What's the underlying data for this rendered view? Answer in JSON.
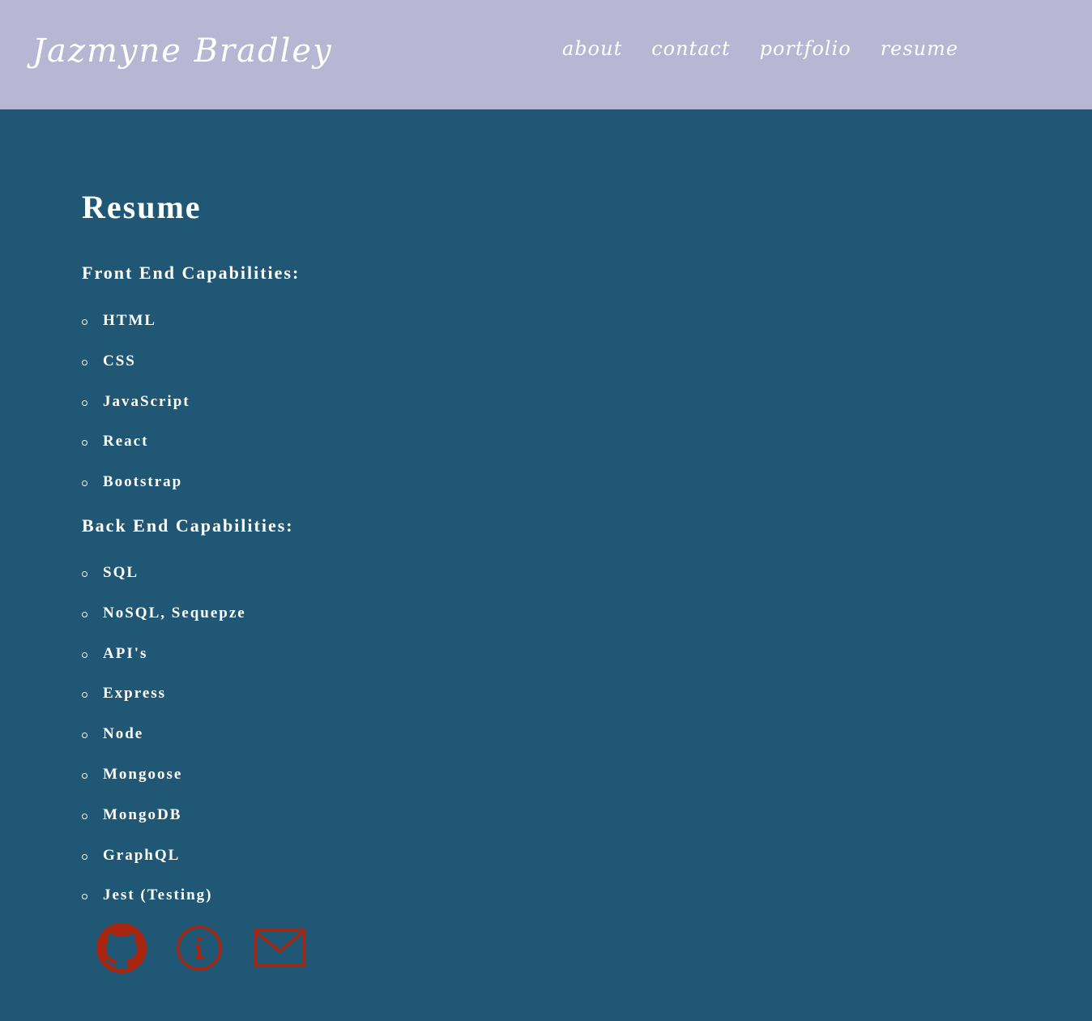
{
  "header": {
    "brand": "Jazmyne Bradley",
    "nav": [
      {
        "label": "about"
      },
      {
        "label": "contact"
      },
      {
        "label": "portfolio"
      },
      {
        "label": "resume"
      }
    ]
  },
  "main": {
    "title": "Resume",
    "front_end": {
      "heading": "Front End Capabilities:",
      "items": [
        "HTML",
        "CSS",
        "JavaScript",
        "React",
        "Bootstrap"
      ]
    },
    "back_end": {
      "heading": "Back End Capabilities:",
      "items": [
        "SQL",
        "NoSQL, Sequepze",
        "API's",
        "Express",
        "Node",
        "Mongoose",
        "MongoDB",
        "GraphQL",
        "Jest (Testing)"
      ]
    }
  },
  "footer": {
    "icons": [
      "github-icon",
      "info-icon",
      "mail-icon"
    ],
    "icon_color": "#a8260f"
  },
  "colors": {
    "header_bg": "#b7b7d4",
    "page_bg": "#205775",
    "text": "#ffffff"
  }
}
